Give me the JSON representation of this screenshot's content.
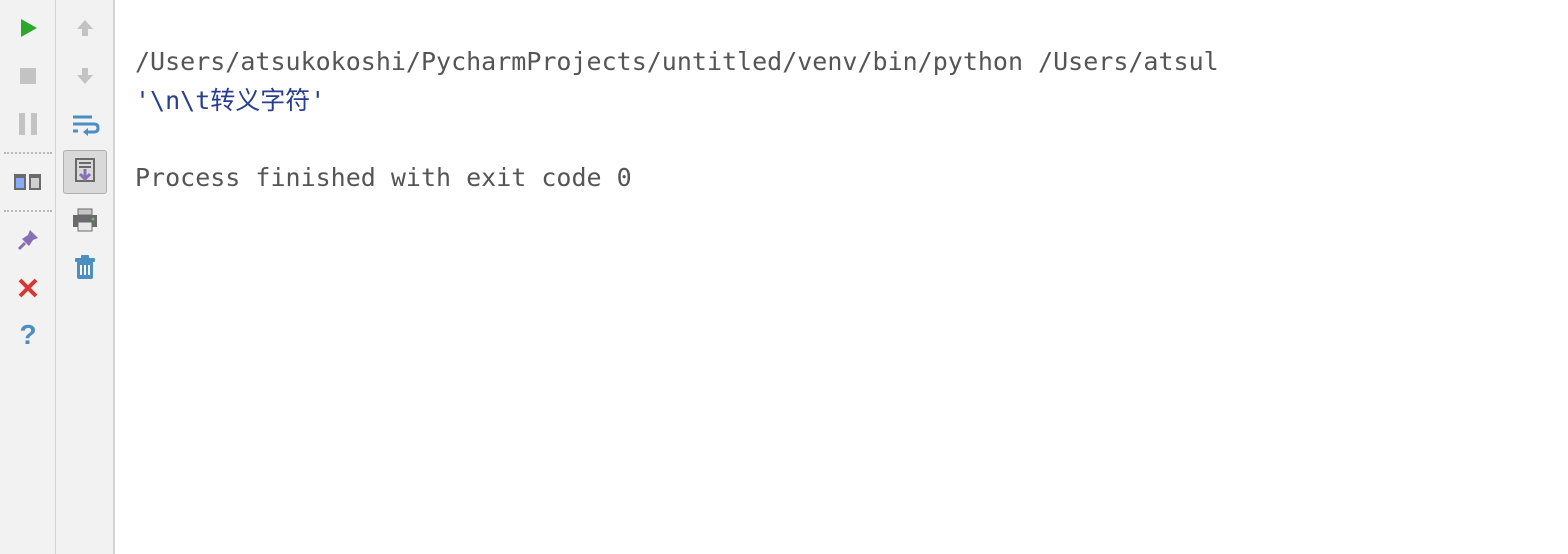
{
  "console": {
    "command_line": "/Users/atsukokoshi/PycharmProjects/untitled/venv/bin/python /Users/atsul",
    "output_line": "'\\n\\t转义字符'",
    "exit_line": "Process finished with exit code 0"
  },
  "icons": {
    "run": "run-icon",
    "stop": "stop-icon",
    "pause": "pause-icon",
    "layout": "layout-icon",
    "pin": "pin-icon",
    "close": "close-icon",
    "help": "help-icon",
    "up": "up-arrow-icon",
    "down": "down-arrow-icon",
    "wrap": "soft-wrap-icon",
    "scroll_end": "scroll-to-end-icon",
    "print": "print-icon",
    "trash": "clear-all-icon"
  }
}
